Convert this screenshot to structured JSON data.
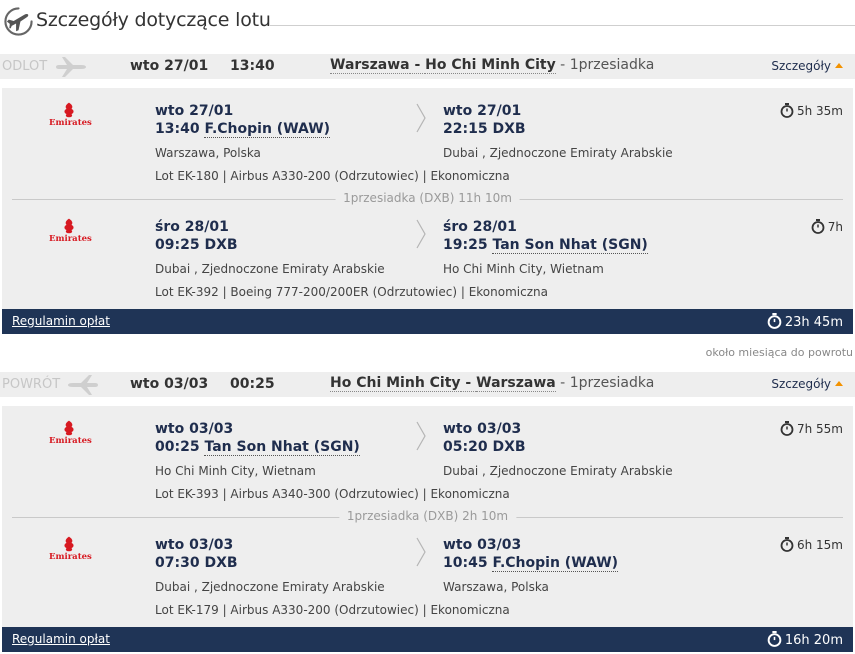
{
  "header": {
    "title": "Szczegóły dotyczące lotu",
    "icon": "plane-circle-icon"
  },
  "outbound": {
    "direction_label": "ODLOT",
    "date": "wto 27/01",
    "time": "13:40",
    "origin": "Warszawa",
    "destination": "Ho Chi Minh City",
    "stops": "1przesiadka",
    "details_label": "Szczegóły",
    "segments": [
      {
        "airline_logo_text": "Emirates",
        "dep_date": "wto 27/01",
        "dep_time": "13:40",
        "dep_airport": "F.Chopin (WAW)",
        "dep_place": "Warszawa, Polska",
        "arr_date": "wto 27/01",
        "arr_time": "22:15",
        "arr_airport": "DXB",
        "arr_place": "Dubai , Zjednoczone Emiraty Arabskie",
        "meta": "Lot EK-180 |  Airbus A330-200 (Odrzutowiec) |  Ekonomiczna",
        "duration": "5h 35m"
      },
      {
        "airline_logo_text": "Emirates",
        "dep_date": "śro 28/01",
        "dep_time": "09:25",
        "dep_airport": "DXB",
        "dep_place": "Dubai , Zjednoczone Emiraty Arabskie",
        "arr_date": "śro 28/01",
        "arr_time": "19:25",
        "arr_airport": "Tan Son Nhat (SGN)",
        "arr_place": "Ho Chi Minh City, Wietnam",
        "meta": "Lot EK-392 |  Boeing 777-200/200ER (Odrzutowiec) |  Ekonomiczna",
        "duration": "7h"
      }
    ],
    "layover": "1przesiadka (DXB) 11h 10m",
    "fees_link": "Regulamin opłat",
    "total_duration": "23h 45m"
  },
  "return_note": "około miesiąca do powrotu",
  "inbound": {
    "direction_label": "POWRÓT",
    "date": "wto 03/03",
    "time": "00:25",
    "origin": "Ho Chi Minh City",
    "destination": "Warszawa",
    "stops": "1przesiadka",
    "details_label": "Szczegóły",
    "segments": [
      {
        "airline_logo_text": "Emirates",
        "dep_date": "wto 03/03",
        "dep_time": "00:25",
        "dep_airport": "Tan Son Nhat (SGN)",
        "dep_place": "Ho Chi Minh City, Wietnam",
        "arr_date": "wto 03/03",
        "arr_time": "05:20",
        "arr_airport": "DXB",
        "arr_place": "Dubai , Zjednoczone Emiraty Arabskie",
        "meta": "Lot EK-393 |  Airbus A340-300 (Odrzutowiec) |  Ekonomiczna",
        "duration": "7h 55m"
      },
      {
        "airline_logo_text": "Emirates",
        "dep_date": "wto 03/03",
        "dep_time": "07:30",
        "dep_airport": "DXB",
        "dep_place": "Dubai , Zjednoczone Emiraty Arabskie",
        "arr_date": "wto 03/03",
        "arr_time": "10:45",
        "arr_airport": "F.Chopin (WAW)",
        "arr_place": "Warszawa, Polska",
        "meta": "Lot EK-179 |  Airbus A330-200 (Odrzutowiec) |  Ekonomiczna",
        "duration": "6h 15m"
      }
    ],
    "layover": "1przesiadka (DXB) 2h 10m",
    "fees_link": "Regulamin opłat",
    "total_duration": "16h 20m"
  },
  "colors": {
    "navy": "#1f3456",
    "text_navy": "#1f2d4d",
    "panel_bg": "#eeeeee",
    "accent_orange": "#f39200",
    "emirates_red": "#d71921"
  }
}
